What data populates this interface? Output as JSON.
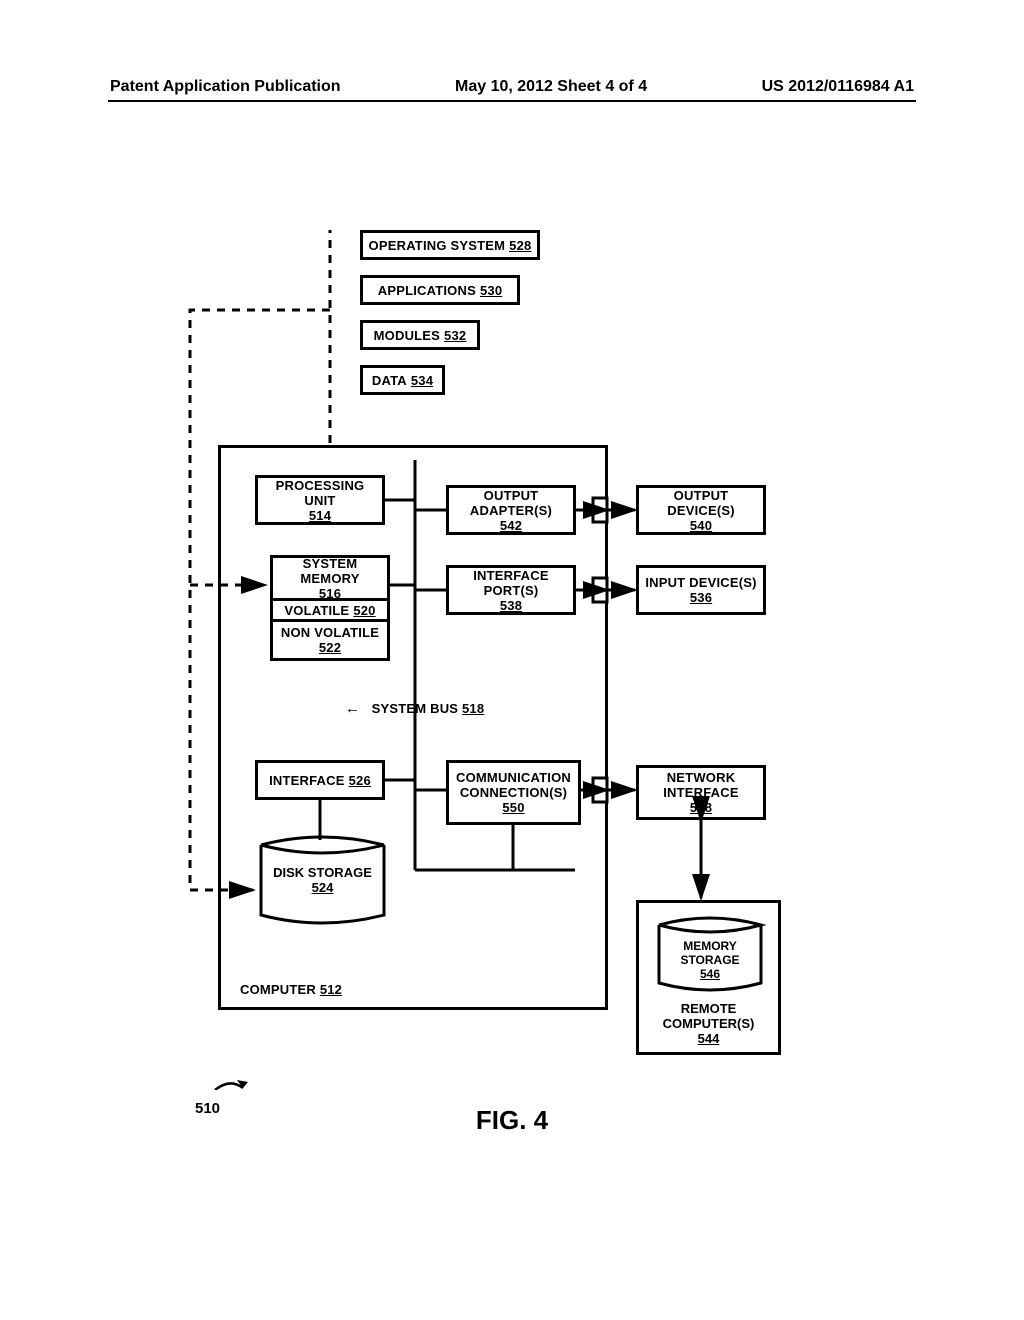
{
  "header": {
    "left": "Patent Application Publication",
    "center": "May 10, 2012  Sheet 4 of 4",
    "right": "US 2012/0116984 A1"
  },
  "figure": "FIG. 4",
  "ref510": "510",
  "boxes": {
    "os": {
      "label": "OPERATING SYSTEM",
      "num": "528"
    },
    "apps": {
      "label": "APPLICATIONS",
      "num": "530"
    },
    "modules": {
      "label": "MODULES",
      "num": "532"
    },
    "data": {
      "label": "DATA",
      "num": "534"
    },
    "proc": {
      "label": "PROCESSING UNIT",
      "num": "514"
    },
    "outadap": {
      "label": "OUTPUT ADAPTER(S)",
      "num": "542"
    },
    "outdev": {
      "label": "OUTPUT DEVICE(S)",
      "num": "540"
    },
    "sysmem": {
      "label": "SYSTEM MEMORY",
      "num": "516"
    },
    "vol": {
      "label": "VOLATILE",
      "num": "520"
    },
    "nvol": {
      "label": "NON VOLATILE",
      "num": "522"
    },
    "ifport": {
      "label": "INTERFACE PORT(S)",
      "num": "538"
    },
    "indev": {
      "label": "INPUT DEVICE(S)",
      "num": "536"
    },
    "iface": {
      "label": "INTERFACE",
      "num": "526"
    },
    "comm": {
      "label": "COMMUNICATION CONNECTION(S)",
      "num": "550"
    },
    "netif": {
      "label": "NETWORK INTERFACE",
      "num": "548"
    },
    "disk": {
      "label": "DISK STORAGE",
      "num": "524"
    },
    "memstor": {
      "label": "MEMORY STORAGE",
      "num": "546"
    },
    "remote": {
      "label": "REMOTE COMPUTER(S)",
      "num": "544"
    },
    "sysbus": {
      "label": "SYSTEM BUS",
      "num": "518"
    },
    "computer": {
      "label": "COMPUTER",
      "num": "512"
    }
  }
}
